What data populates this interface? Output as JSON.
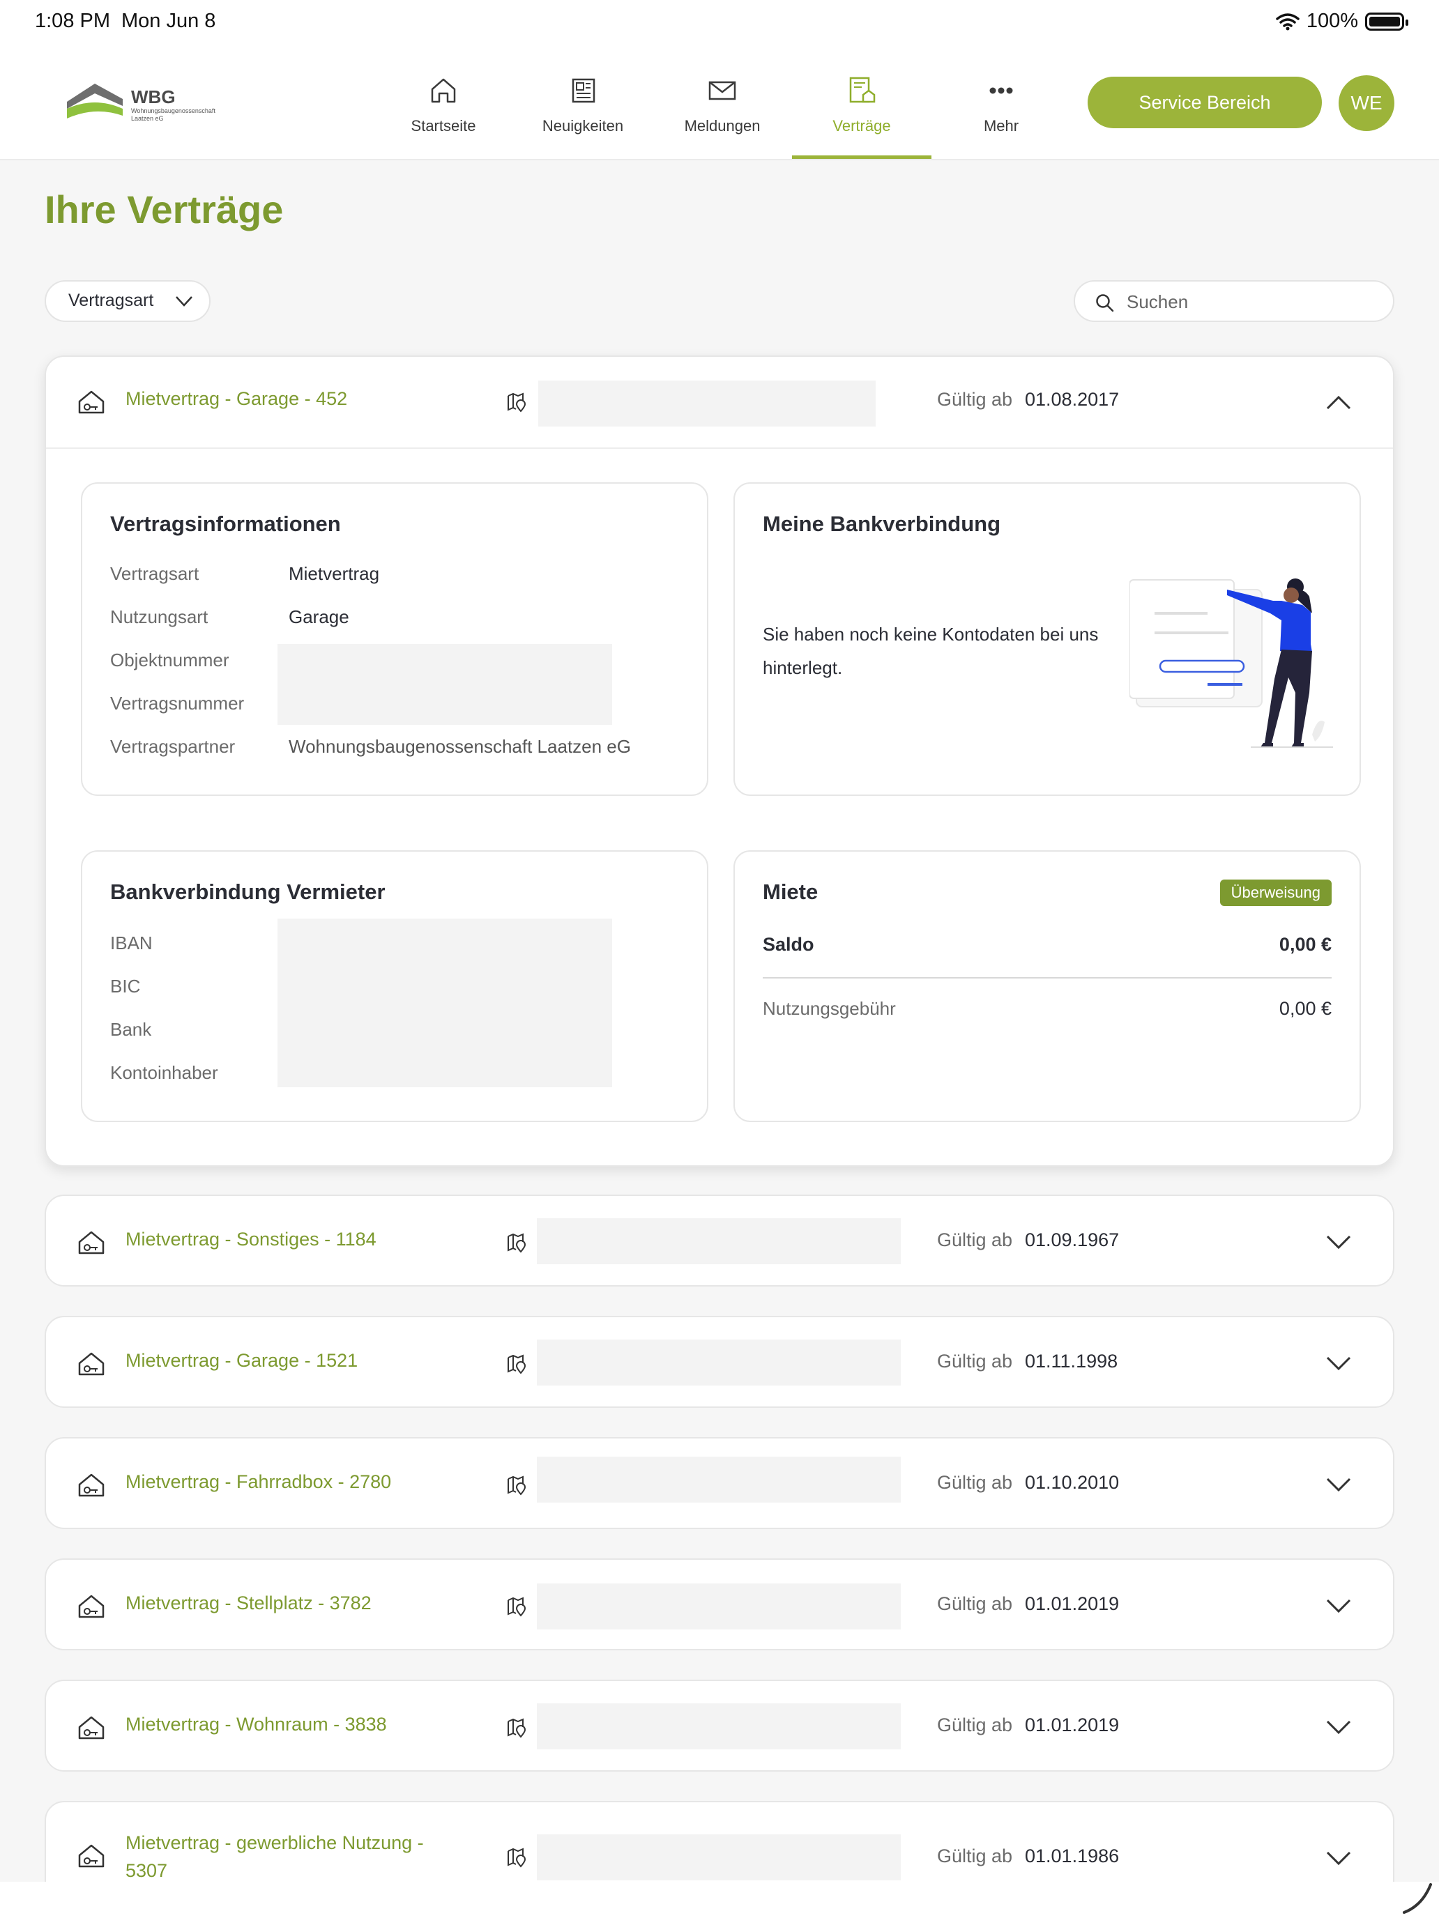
{
  "status_bar": {
    "time": "1:08 PM",
    "date": "Mon Jun 8",
    "battery": "100%"
  },
  "header": {
    "logo_text": "WBG",
    "logo_sub": "Wohnungsbaugenossenschaft Laatzen eG",
    "nav": [
      {
        "label": "Startseite",
        "icon": "home-icon"
      },
      {
        "label": "Neuigkeiten",
        "icon": "newspaper-icon"
      },
      {
        "label": "Meldungen",
        "icon": "mail-icon"
      },
      {
        "label": "Verträge",
        "icon": "contract-icon",
        "active": true
      },
      {
        "label": "Mehr",
        "icon": "more-icon"
      }
    ],
    "service_button": "Service Bereich",
    "avatar": "WE"
  },
  "page": {
    "title": "Ihre Verträge",
    "filter_label": "Vertragsart",
    "search_placeholder": "Suchen"
  },
  "valid_label": "Gültig ab",
  "contracts": [
    {
      "title": "Mietvertrag - Garage - 452",
      "valid_from": "01.08.2017",
      "expanded": true
    },
    {
      "title": "Mietvertrag - Sonstiges - 1184",
      "valid_from": "01.09.1967"
    },
    {
      "title": "Mietvertrag - Garage - 1521",
      "valid_from": "01.11.1998"
    },
    {
      "title": "Mietvertrag - Fahrradbox - 2780",
      "valid_from": "01.10.2010"
    },
    {
      "title": "Mietvertrag - Stellplatz - 3782",
      "valid_from": "01.01.2019"
    },
    {
      "title": "Mietvertrag - Wohnraum - 3838",
      "valid_from": "01.01.2019"
    },
    {
      "title": "Mietvertrag - gewerbliche Nutzung - 5307",
      "valid_from": "01.01.1986"
    }
  ],
  "details": {
    "vertragsinfo": {
      "title": "Vertragsinformationen",
      "rows": [
        {
          "key": "Vertragsart",
          "value": "Mietvertrag"
        },
        {
          "key": "Nutzungsart",
          "value": "Garage"
        },
        {
          "key": "Objektnummer",
          "value": ""
        },
        {
          "key": "Vertragsnummer",
          "value": ""
        },
        {
          "key": "Vertragspartner",
          "value": "Wohnungsbaugenossenschaft Laatzen eG"
        }
      ]
    },
    "bankverbindung": {
      "title": "Meine Bankverbindung",
      "message": "Sie haben noch keine Kontodaten bei uns hinterlegt."
    },
    "vermieter": {
      "title": "Bankverbindung Vermieter",
      "keys": [
        "IBAN",
        "BIC",
        "Bank",
        "Kontoinhaber"
      ]
    },
    "miete": {
      "title": "Miete",
      "badge": "Überweisung",
      "saldo_label": "Saldo",
      "saldo_value": "0,00 €",
      "fee_label": "Nutzungsgebühr",
      "fee_value": "0,00 €"
    }
  },
  "colors": {
    "accent": "#9cb43a",
    "accent_dark": "#7d9a30",
    "background": "#f6f6f6",
    "redacted": "#f3f3f3"
  }
}
